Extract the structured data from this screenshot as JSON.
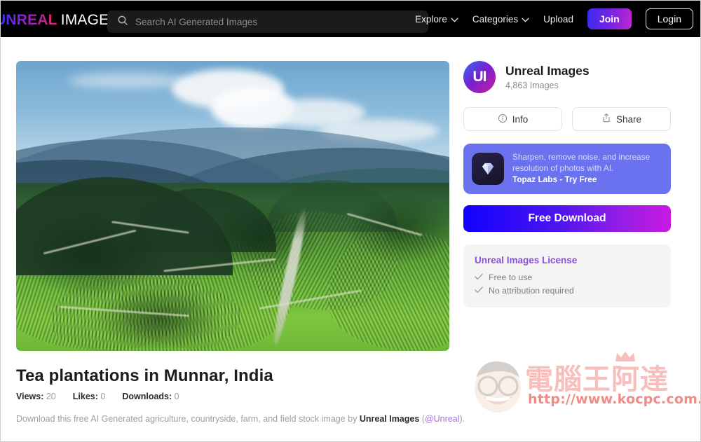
{
  "header": {
    "logo_primary": "UNREAL",
    "logo_secondary": "IMAGES",
    "search": {
      "placeholder": "Search AI Generated Images",
      "value": "",
      "icon": "search-icon"
    },
    "nav": [
      {
        "label": "Explore",
        "has_chevron": true
      },
      {
        "label": "Categories",
        "has_chevron": true
      },
      {
        "label": "Upload",
        "has_chevron": false
      }
    ],
    "join_label": "Join",
    "login_label": "Login",
    "colors": {
      "bar_background": "#000000",
      "search_background": "#1b1b1b",
      "join_gradient_start": "#3b2bf0",
      "join_gradient_end": "#c026d3"
    }
  },
  "photo": {
    "alt": "Tea plantations terraced on green hills with blue hazy mountains and clouds"
  },
  "details": {
    "title": "Tea plantations in Munnar, India",
    "stats": [
      {
        "label": "Views:",
        "value": "20"
      },
      {
        "label": "Likes:",
        "value": "0"
      },
      {
        "label": "Downloads:",
        "value": "0"
      }
    ],
    "description_prefix": "Download this free AI Generated agriculture, countryside, farm, and field stock image by ",
    "description_author": "Unreal Images",
    "description_middle": " (",
    "description_handle": "@Unreal",
    "description_suffix": ")."
  },
  "sidebar": {
    "owner": {
      "avatar_initials": "UI",
      "name": "Unreal Images",
      "image_count": "4,863 Images"
    },
    "buttons": [
      {
        "label": "Info",
        "icon": "info-circle-icon"
      },
      {
        "label": "Share",
        "icon": "share-upload-icon"
      }
    ],
    "ad": {
      "icon": "diamond-gem-icon",
      "line1": "Sharpen, remove noise, and increase",
      "line2": "resolution of photos with AI.",
      "cta": "Topaz Labs - Try Free",
      "background": "#6b72ef"
    },
    "download_label": "Free Download",
    "license": {
      "title": "Unreal Images License",
      "items": [
        "Free to use",
        "No attribution required"
      ],
      "title_color": "#8b4ddb"
    }
  },
  "watermark": {
    "chinese": "電腦王阿達",
    "url": "http://www.kocpc.com.tw",
    "color": "#e8453c"
  }
}
